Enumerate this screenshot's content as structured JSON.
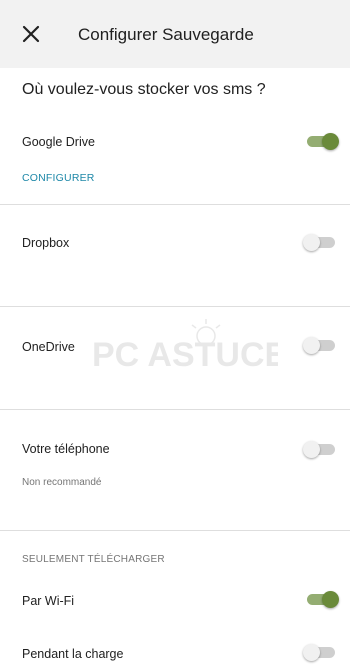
{
  "header": {
    "title": "Configurer Sauvegarde"
  },
  "question": "Où voulez-vous stocker vos sms ?",
  "storage": {
    "google_drive": {
      "label": "Google Drive",
      "enabled": true,
      "action": "CONFIGURER"
    },
    "dropbox": {
      "label": "Dropbox",
      "enabled": false
    },
    "onedrive": {
      "label": "OneDrive",
      "enabled": false
    },
    "phone": {
      "label": "Votre téléphone",
      "enabled": false,
      "note": "Non recommandé"
    }
  },
  "upload_section": {
    "header": "SEULEMENT TÉLÉCHARGER",
    "wifi": {
      "label": "Par Wi-Fi",
      "enabled": true
    },
    "charging": {
      "label": "Pendant la charge",
      "enabled": false
    }
  },
  "watermark": {
    "text": "PC ASTUCES"
  },
  "colors": {
    "accent": "#6a8a3a",
    "accent_track": "#94ad72",
    "link": "#1e88a8",
    "app_bar": "#f2f2f2"
  },
  "icons": {
    "close": "close-icon"
  }
}
